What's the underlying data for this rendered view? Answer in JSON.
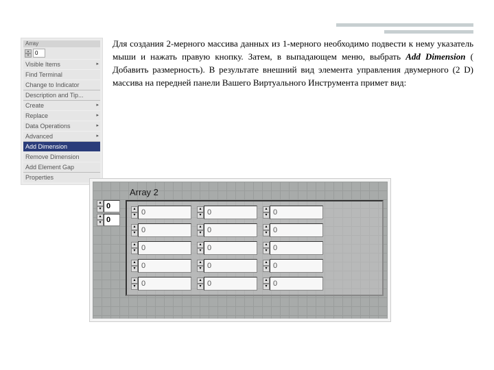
{
  "decor": {},
  "menu": {
    "topLabel": "Array",
    "indexValue": "0",
    "items": [
      {
        "label": "Visible Items",
        "arrow": true,
        "sep": false,
        "hl": false
      },
      {
        "label": "Find Terminal",
        "arrow": false,
        "sep": false,
        "hl": false
      },
      {
        "label": "Change to Indicator",
        "arrow": false,
        "sep": false,
        "hl": false
      },
      {
        "label": "Description and Tip...",
        "arrow": false,
        "sep": true,
        "hl": false
      },
      {
        "label": "Create",
        "arrow": true,
        "sep": true,
        "hl": false
      },
      {
        "label": "Replace",
        "arrow": true,
        "sep": false,
        "hl": false
      },
      {
        "label": "Data Operations",
        "arrow": true,
        "sep": false,
        "hl": false
      },
      {
        "label": "Advanced",
        "arrow": true,
        "sep": false,
        "hl": false
      },
      {
        "label": "Add Dimension",
        "arrow": false,
        "sep": true,
        "hl": true
      },
      {
        "label": "Remove Dimension",
        "arrow": false,
        "sep": false,
        "hl": false
      },
      {
        "label": "Add Element Gap",
        "arrow": false,
        "sep": false,
        "hl": false
      },
      {
        "label": "Properties",
        "arrow": false,
        "sep": true,
        "hl": false
      }
    ]
  },
  "paragraph": {
    "t1": "Для создания 2-мерного массива данных из 1-мерного необходимо подвести к нему указатель мыши и нажать правую кнопку. Затем, в выпадающем меню, выбрать ",
    "bi": "Add Dimension",
    "t2": " ( Добавить размерность). В результате внешний вид элемента управления двумерного (2 D) массива на передней панели Вашего Виртуального Инструмента примет вид:"
  },
  "array": {
    "title": "Array 2",
    "indices": [
      "0",
      "0"
    ],
    "rows": [
      [
        "0",
        "0",
        "0"
      ],
      [
        "0",
        "0",
        "0"
      ],
      [
        "0",
        "0",
        "0"
      ],
      [
        "0",
        "0",
        "0"
      ],
      [
        "0",
        "0",
        "0"
      ]
    ]
  }
}
